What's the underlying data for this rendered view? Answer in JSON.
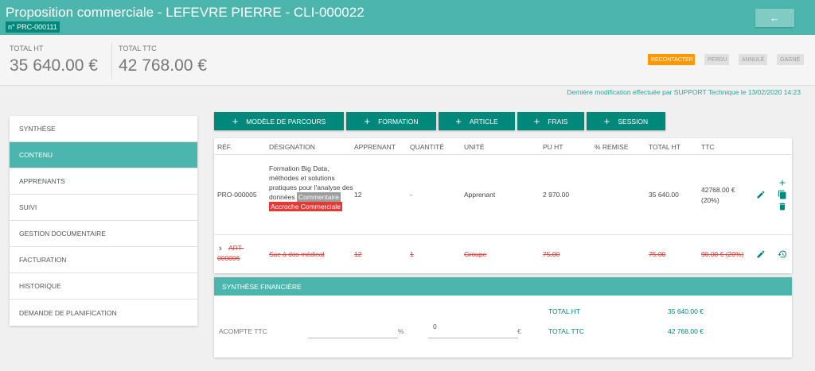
{
  "header": {
    "title": "Proposition commerciale - LEFEVRE PIERRE - CLI-000022",
    "code": "n° PRC-000111",
    "back_icon": "arrow-left-icon"
  },
  "totals": {
    "ht_label": "TOTAL HT",
    "ht_value": "35 640.00 €",
    "ttc_label": "TOTAL TTC",
    "ttc_value": "42 768.00 €"
  },
  "statuses": [
    "RECONTACTER",
    "PERDU",
    "ANNULÉ",
    "GAGNÉ"
  ],
  "last_modified": "Dernière modification effectuée par SUPPORT Technique le 13/02/2020 14:23",
  "nav": [
    "SYNTHÈSE",
    "CONTENU",
    "APPRENANTS",
    "SUIVI",
    "GESTION DOCUMENTAIRE",
    "FACTURATION",
    "HISTORIQUE",
    "DEMANDE DE PLANIFICATION"
  ],
  "add_buttons": [
    "MODÈLE DE PARCOURS",
    "FORMATION",
    "ARTICLE",
    "FRAIS",
    "SESSION"
  ],
  "table": {
    "columns": [
      "RÉF.",
      "DÉSIGNATION",
      "APPRENANT",
      "QUANTITÉ",
      "UNITÉ",
      "PU HT",
      "% REMISE",
      "TOTAL HT",
      "TTC"
    ],
    "row1": {
      "ref": "PRO-000005",
      "designation": "Formation Big Data, méthodes et solutions pratiques pour l'analyse des données",
      "tag1": "Commentaire",
      "tag2": "Accroche Commerciale",
      "apprenant": "12",
      "quantite": "-",
      "unite": "Apprenant",
      "pu_ht": "2 970.00",
      "total_ht": "35 640.00",
      "ttc_line1": "42768.00 €",
      "ttc_line2": "(20%)"
    },
    "row2": {
      "ref_line1": "ART-",
      "ref_line2": "000006",
      "designation": "Sac à dos médical",
      "apprenant": "12",
      "quantite": "1",
      "unite": "Groupe",
      "pu_ht": "75.00",
      "total_ht": "75.00",
      "ttc": "90.00 € (20%)"
    }
  },
  "finance": {
    "title": "SYNTHÈSE FINANCIÈRE",
    "acompte_label": "ACOMPTE TTC",
    "percent_symbol": "%",
    "amount_value": "0",
    "euro_symbol": "€",
    "total_ht_label": "TOTAL HT",
    "total_ht_value": "35 640.00 €",
    "total_ttc_label": "TOTAL TTC",
    "total_ttc_value": "42 768.00 €"
  },
  "colors": {
    "primary": "#4db6ac",
    "primary_dark": "#00897b",
    "warning": "#ff9800",
    "danger": "#e53935"
  }
}
